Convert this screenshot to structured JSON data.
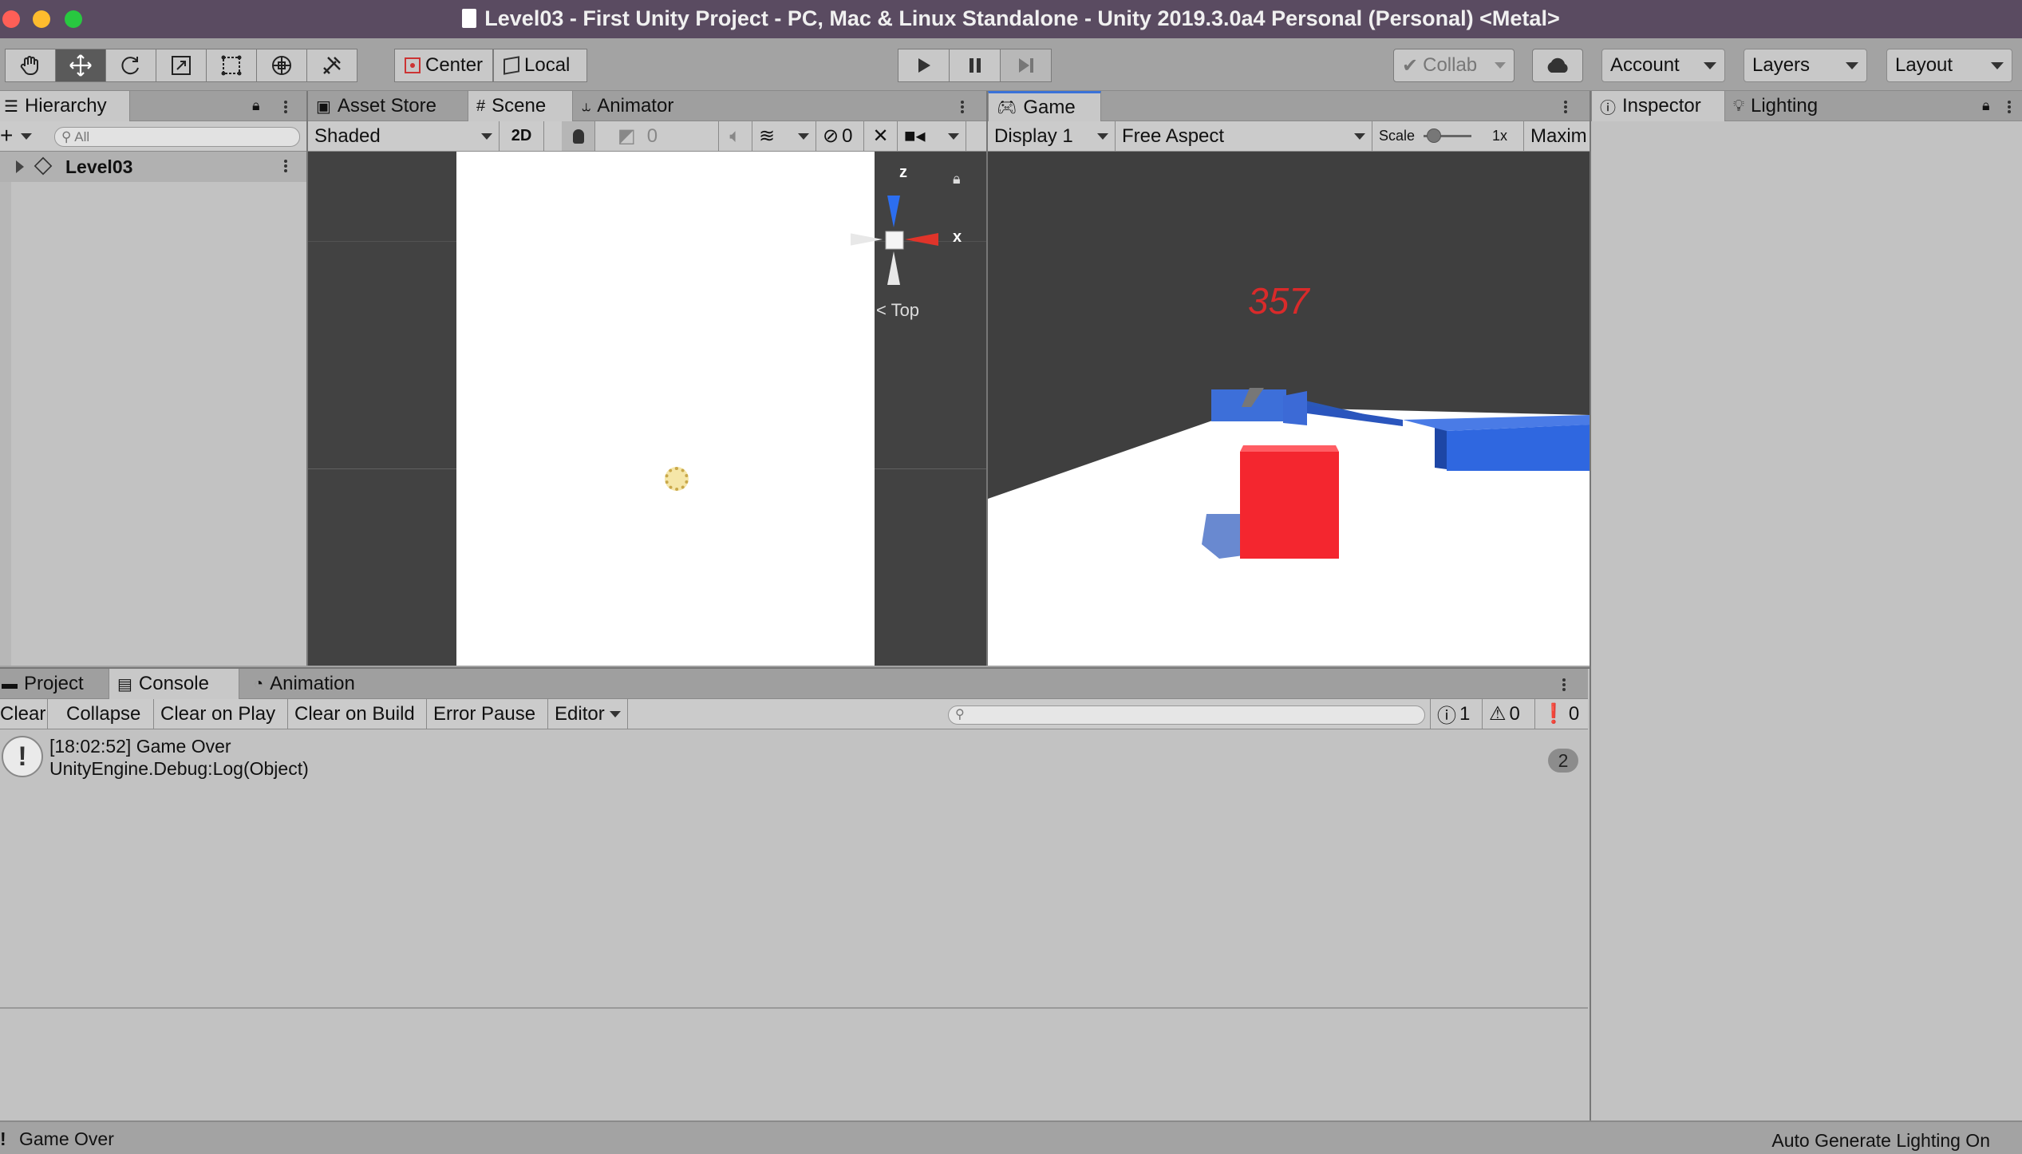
{
  "window": {
    "title": "Level03 - First Unity Project - PC, Mac & Linux Standalone - Unity 2019.3.0a4 Personal (Personal) <Metal>"
  },
  "toolbar": {
    "tools": [
      "hand-tool",
      "move-tool",
      "rotate-tool",
      "scale-tool",
      "rect-tool",
      "transform-tool",
      "custom-tool"
    ],
    "pivot_label": "Center",
    "space_label": "Local",
    "collab_label": "Collab",
    "account_label": "Account",
    "layers_label": "Layers",
    "layout_label": "Layout"
  },
  "hierarchy": {
    "tab_label": "Hierarchy",
    "search_placeholder": "All",
    "scene_name": "Level03"
  },
  "scene_panel": {
    "tabs": [
      "Asset Store",
      "Scene",
      "Animator"
    ],
    "active_tab": "Scene",
    "shading_mode": "Shaded",
    "mode_2d": "2D",
    "audio_count": "0",
    "hidden_count": "0",
    "gizmo_axes": {
      "z": "z",
      "x": "x"
    },
    "view_label": "Top"
  },
  "game_panel": {
    "tab_label": "Game",
    "display": "Display 1",
    "aspect": "Free Aspect",
    "scale_label": "Scale",
    "scale_value": "1x",
    "maximize_label": "Maxim",
    "score": "357"
  },
  "inspector": {
    "tabs": [
      "Inspector",
      "Lighting"
    ]
  },
  "bottom_panel": {
    "tabs": [
      "Project",
      "Console",
      "Animation"
    ],
    "active_tab": "Console",
    "buttons": [
      "Clear",
      "Collapse",
      "Clear on Play",
      "Clear on Build",
      "Error Pause",
      "Editor"
    ],
    "counts": {
      "log": "1",
      "warning": "0",
      "error": "0"
    },
    "log_entries": [
      {
        "line1": "[18:02:52] Game Over",
        "line2": "UnityEngine.Debug:Log(Object)",
        "count": "2"
      }
    ]
  },
  "statusbar": {
    "message": "Game Over",
    "right_text": "Auto Generate Lighting On"
  },
  "colors": {
    "title_bar": "#5a4b61",
    "panel_bg": "#a3a3a3",
    "score_color": "#d92a2a",
    "cube_red": "#f4262f",
    "blue_walls": "#2f67e0"
  }
}
